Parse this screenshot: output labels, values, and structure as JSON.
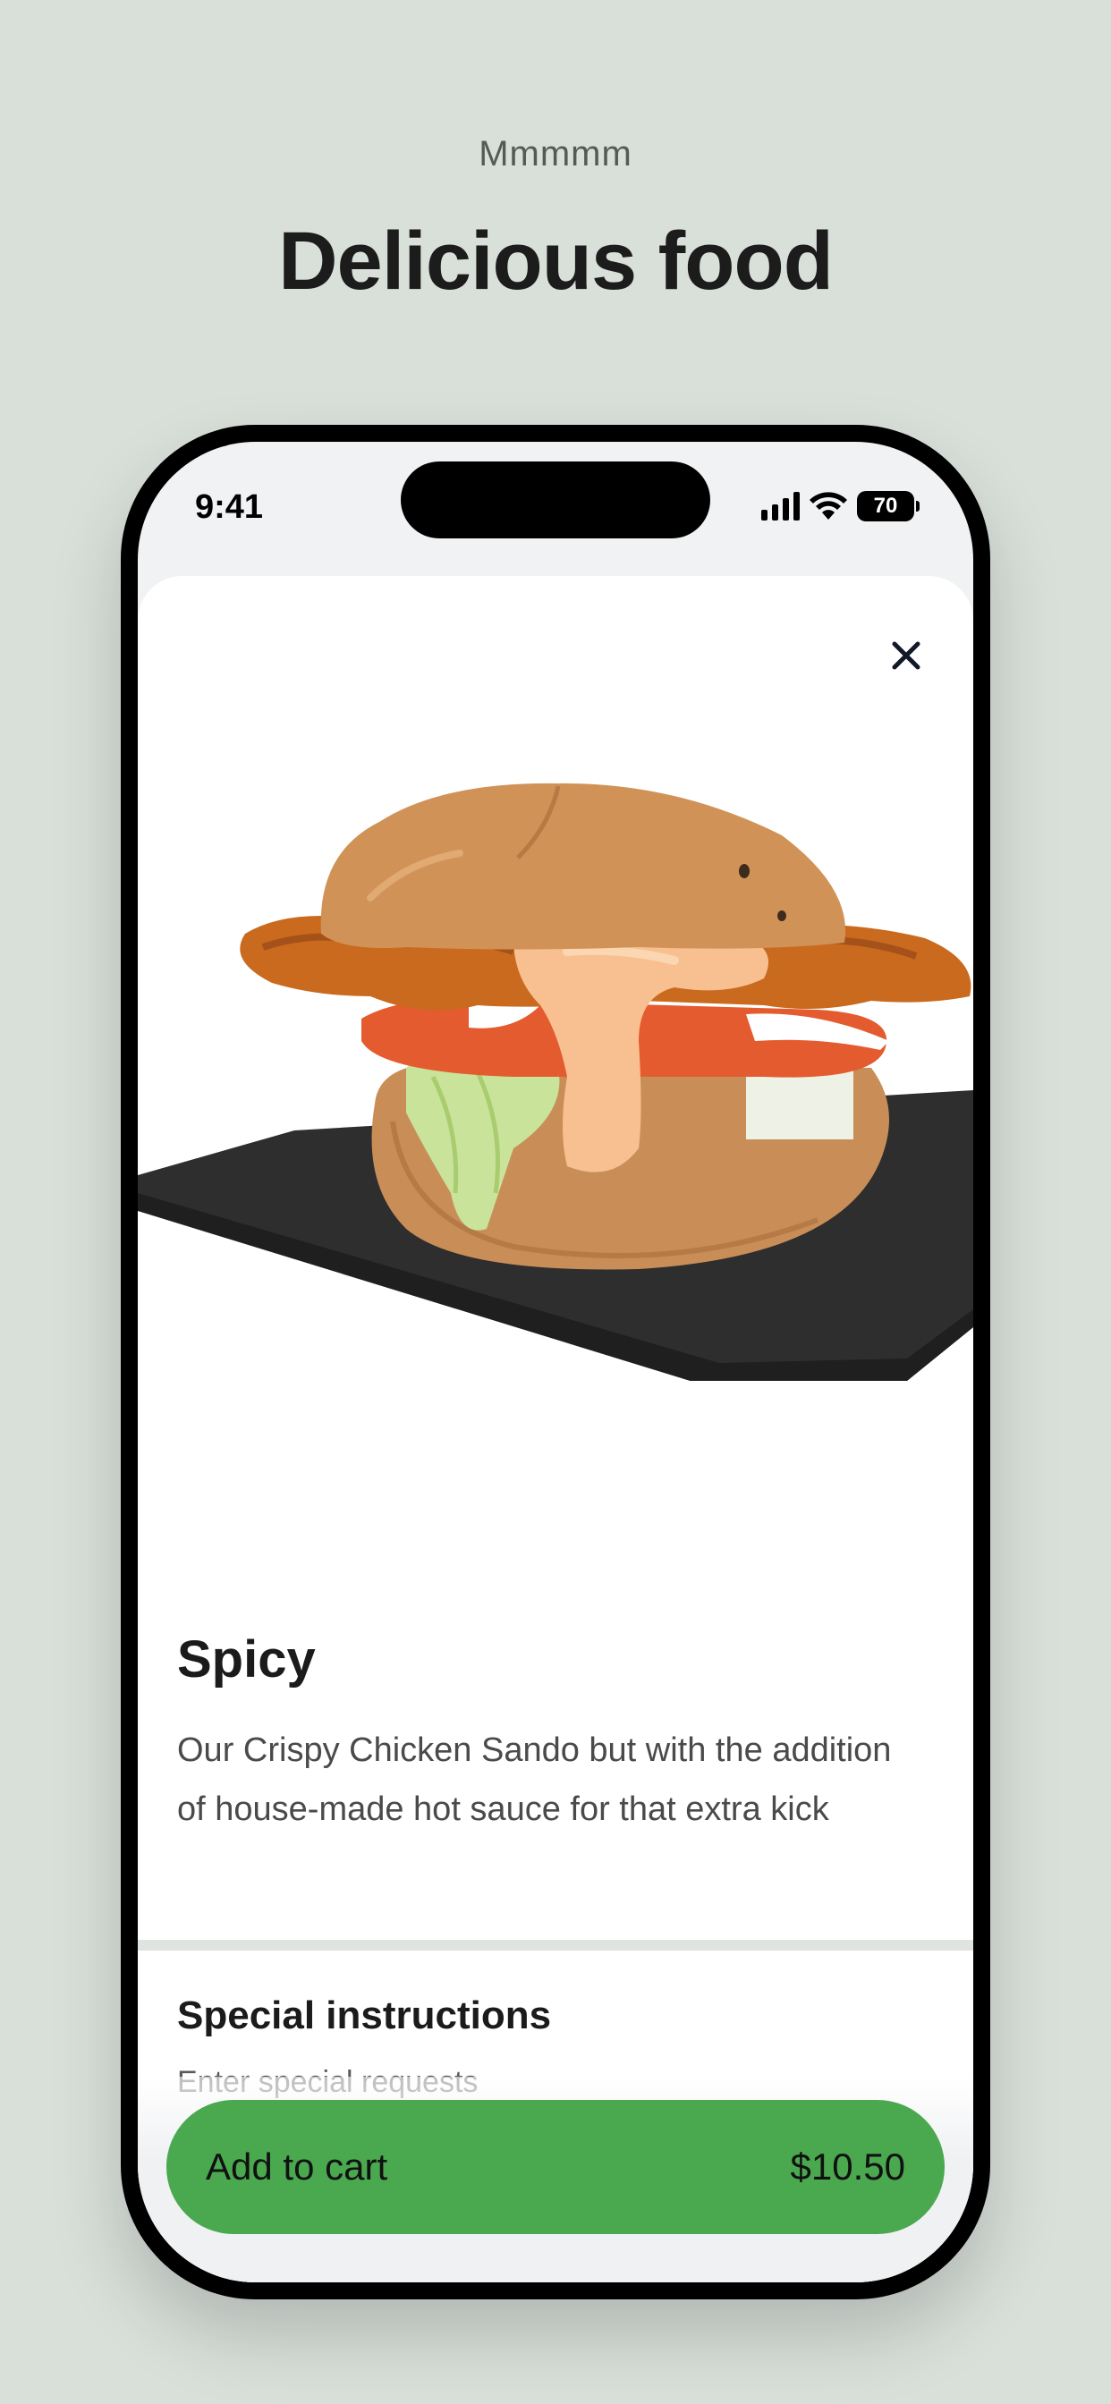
{
  "header": {
    "eyebrow": "Mmmmm",
    "title": "Delicious food"
  },
  "status_bar": {
    "time": "9:41",
    "battery": "70",
    "icons": [
      "signal-icon",
      "wifi-icon",
      "battery-icon"
    ]
  },
  "item": {
    "image": "crispy-chicken-sandwich-photo",
    "name": "Spicy",
    "description": "Our Crispy Chicken Sando but with the addition of house-made hot sauce for that extra kick"
  },
  "special_instructions": {
    "title": "Special instructions",
    "placeholder": "Enter special requests"
  },
  "cart_button": {
    "label": "Add to cart",
    "price": "$10.50"
  },
  "colors": {
    "page_background": "#d9e0da",
    "accent_green": "#4aa84f",
    "text_dark": "#1b1b1b"
  }
}
